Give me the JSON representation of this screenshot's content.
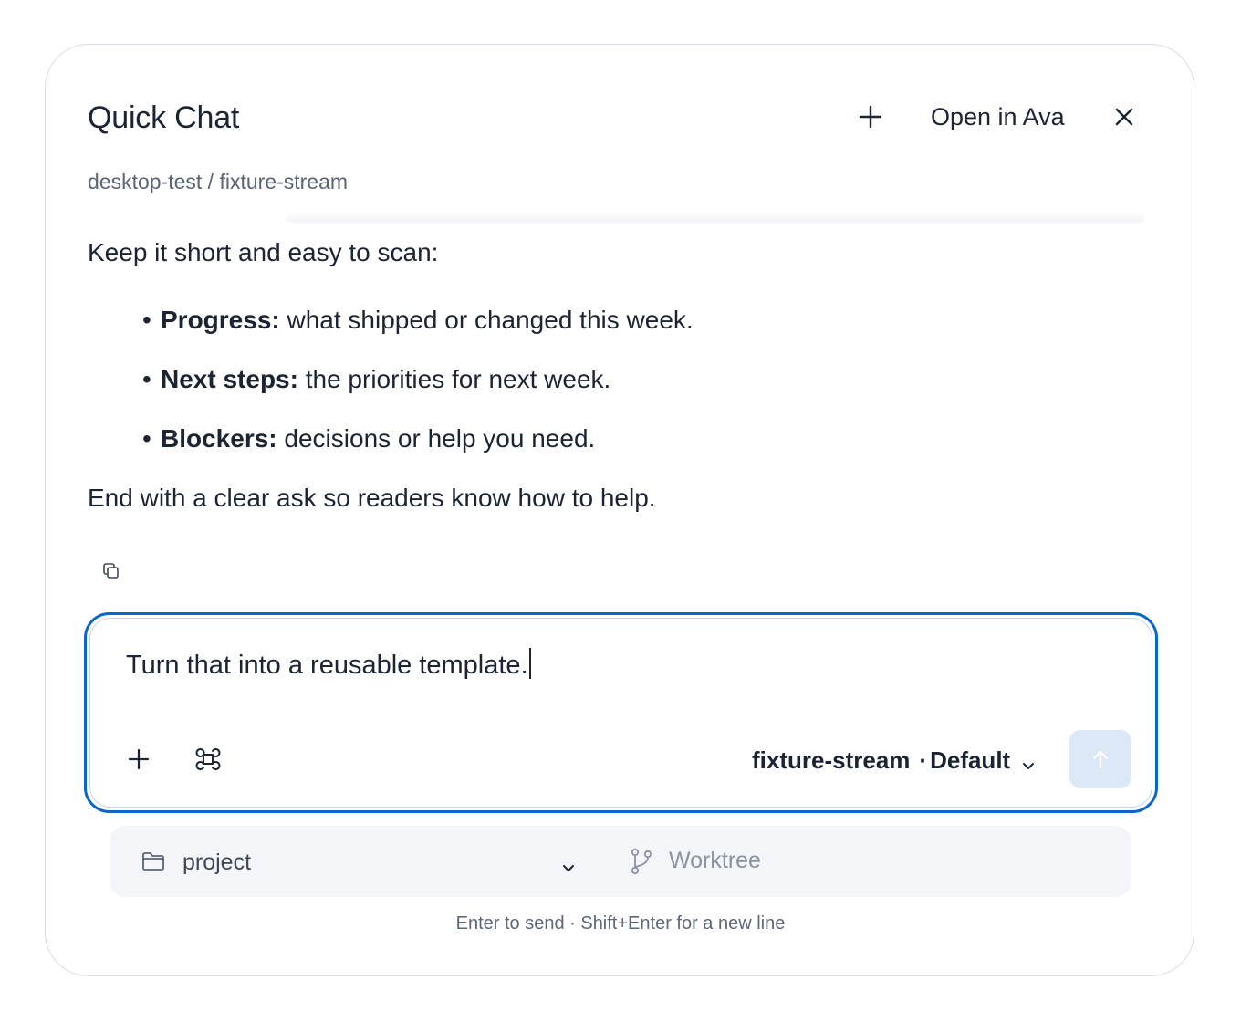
{
  "header": {
    "title": "Quick Chat",
    "open_in_label": "Open in Ava",
    "new_chat_icon": "plus-icon",
    "close_icon": "close-icon"
  },
  "breadcrumb": "desktop-test / fixture-stream",
  "message": {
    "intro": "Keep it short and easy to scan:",
    "bullets": [
      {
        "label": "Progress:",
        "text": " what shipped or changed this week."
      },
      {
        "label": "Next steps:",
        "text": " the priorities for next week."
      },
      {
        "label": "Blockers:",
        "text": " decisions or help you need."
      }
    ],
    "outro": "End with a clear ask so readers know how to help.",
    "copy_icon": "copy-icon"
  },
  "composer": {
    "value": "Turn that into a reusable template.",
    "attach_icon": "plus-icon",
    "command_icon": "command-icon",
    "model_name": "fixture-stream",
    "model_separator": "·",
    "model_variant": "Default",
    "send_icon": "arrow-up-icon"
  },
  "context": {
    "project_label": "project",
    "worktree_label": "Worktree"
  },
  "hint": "Enter to send · Shift+Enter for a new line",
  "colors": {
    "accent": "#0a66c8",
    "send_disabled": "#dde8f7",
    "text": "#1c2433",
    "muted": "#5a6475"
  }
}
